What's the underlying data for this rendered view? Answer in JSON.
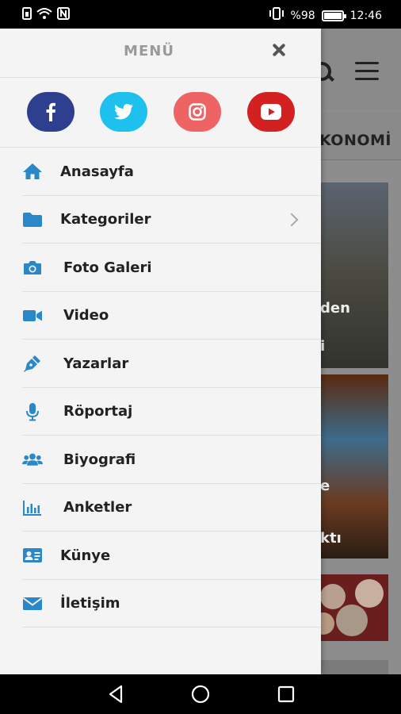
{
  "status_bar": {
    "battery_text": "%98",
    "time": "12:46",
    "battery_level": 0.98
  },
  "background": {
    "category_tab": "KONOMİ",
    "card1_text_1": "den",
    "card1_text_2": "i",
    "card2_text_1": "e",
    "card2_text_2": "ktı"
  },
  "drawer": {
    "title": "MENÜ",
    "social": [
      {
        "name": "facebook",
        "color": "#2f3f8f"
      },
      {
        "name": "twitter",
        "color": "#1ec0ee"
      },
      {
        "name": "instagram",
        "color": "#ee6464"
      },
      {
        "name": "youtube",
        "color": "#d32121"
      }
    ],
    "items": [
      {
        "label": "Anasayfa",
        "icon": "home-icon"
      },
      {
        "label": "Kategoriler",
        "icon": "folder-icon",
        "has_submenu": true
      },
      {
        "label": "Foto Galeri",
        "icon": "camera-icon"
      },
      {
        "label": "Video",
        "icon": "video-camera-icon"
      },
      {
        "label": "Yazarlar",
        "icon": "pen-icon"
      },
      {
        "label": "Röportaj",
        "icon": "microphone-icon"
      },
      {
        "label": "Biyografi",
        "icon": "users-icon"
      },
      {
        "label": "Anketler",
        "icon": "bar-chart-icon"
      },
      {
        "label": "Künye",
        "icon": "id-card-icon"
      },
      {
        "label": "İletişim",
        "icon": "envelope-icon"
      }
    ],
    "icon_color": "#2a88c8"
  }
}
